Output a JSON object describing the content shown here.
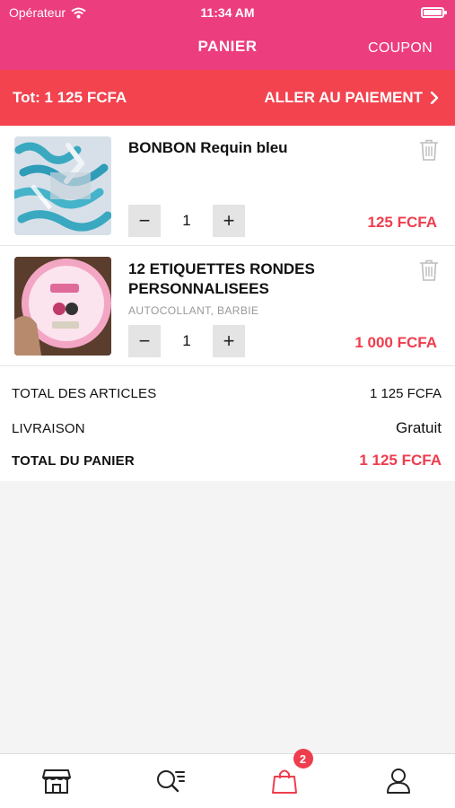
{
  "status": {
    "carrier": "Opérateur",
    "time": "11:34 AM"
  },
  "nav": {
    "title": "PANIER",
    "coupon": "COUPON"
  },
  "checkout": {
    "total": "Tot: 1 125 FCFA",
    "action": "ALLER AU PAIEMENT"
  },
  "items": [
    {
      "name": "BONBON Requin bleu",
      "subtitle": "",
      "qty": "1",
      "price": "125 FCFA"
    },
    {
      "name": "12 ETIQUETTES RONDES PERSONNALISEES",
      "subtitle": "AUTOCOLLANT, BARBIE",
      "qty": "1",
      "price": "1 000 FCFA"
    }
  ],
  "qty_controls": {
    "minus": "−",
    "plus": "+"
  },
  "totals": {
    "articles_label": "TOTAL DES ARTICLES",
    "articles_value": "1 125 FCFA",
    "delivery_label": "LIVRAISON",
    "delivery_value": "Gratuit",
    "cart_label": "TOTAL DU PANIER",
    "cart_value": "1 125 FCFA"
  },
  "tabs": [
    {
      "icon": "store-icon"
    },
    {
      "icon": "search-list-icon"
    },
    {
      "icon": "shopping-bag-icon",
      "badge": "2",
      "active": true
    },
    {
      "icon": "user-icon"
    }
  ],
  "colors": {
    "header": "#ec3d7e",
    "checkout_bar": "#f2434f",
    "accent": "#ef3d4e"
  }
}
